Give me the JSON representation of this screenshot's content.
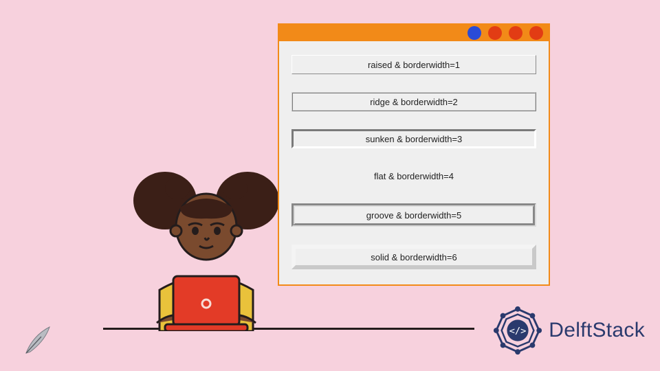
{
  "window": {
    "titlebar": {
      "dots": [
        "#2a4bd7",
        "#e23c14",
        "#e23c14",
        "#e23c14"
      ]
    },
    "labels": [
      {
        "relief": "raised",
        "bw": 1,
        "text": "raised & borderwidth=1"
      },
      {
        "relief": "ridge",
        "bw": 2,
        "text": "ridge & borderwidth=2"
      },
      {
        "relief": "sunken",
        "bw": 3,
        "text": "sunken & borderwidth=3"
      },
      {
        "relief": "flat",
        "bw": 4,
        "text": "flat & borderwidth=4"
      },
      {
        "relief": "groove",
        "bw": 5,
        "text": "groove & borderwidth=5"
      },
      {
        "relief": "solid",
        "bw": 6,
        "text": "solid & borderwidth=6"
      }
    ]
  },
  "branding": {
    "name": "DelftStack",
    "accent": "#2a3a6d"
  }
}
